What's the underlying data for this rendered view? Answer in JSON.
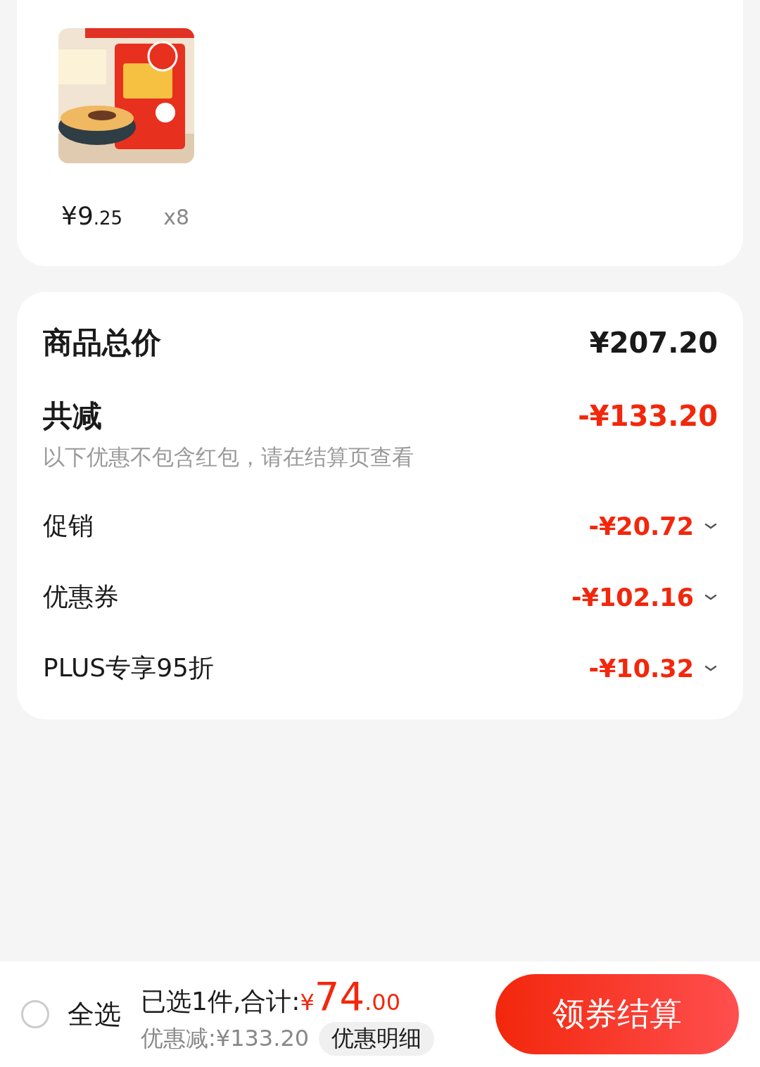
{
  "product": {
    "kind": "picture",
    "price": "¥9.25",
    "quantity": "x8"
  },
  "summary": {
    "total_label": "商品总价",
    "total_value": "¥207.20",
    "discount_label": "共减",
    "discount_value": "-¥133.20",
    "note": "以下优惠不包含红包，请在结算页查看",
    "items": [
      {
        "label": "促销",
        "value": "-¥20.72"
      },
      {
        "label": "优惠券",
        "value": "-¥102.16"
      },
      {
        "label": "PLUS专享95折",
        "value": "-¥10.32"
      }
    ]
  },
  "bottom_bar": {
    "select_all": {
      "label": "全选",
      "checked": false
    },
    "selected_text": "已选1件,合计:",
    "total": "¥74.00",
    "discount_text": "优惠减:¥133.20",
    "detail_button": "优惠明细",
    "checkout_button": "领券结算"
  }
}
